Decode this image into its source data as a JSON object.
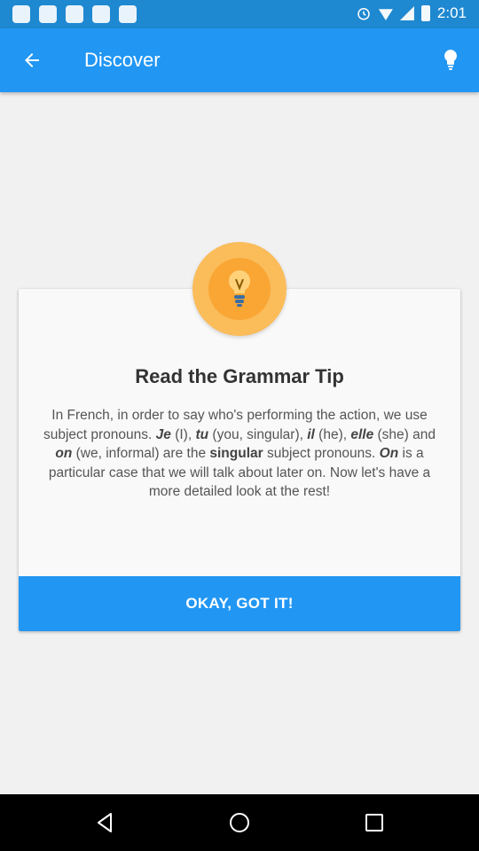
{
  "status_bar": {
    "time": "2:01",
    "icons": [
      "notification-icon",
      "notification-icon",
      "notification-icon",
      "notification-icon",
      "notification-icon",
      "alarm-icon",
      "wifi-icon",
      "cell-signal-icon",
      "battery-icon"
    ]
  },
  "app_bar": {
    "title": "Discover",
    "back_icon": "arrow-back-icon",
    "action_icon": "lightbulb-icon",
    "color": "#2196f3"
  },
  "tip_card": {
    "icon": "lightbulb-icon",
    "title": "Read the Grammar Tip",
    "body": [
      {
        "text": "In French, in order to say who's performing the action, we use subject pronouns. ",
        "style": "normal"
      },
      {
        "text": "Je",
        "style": "bold-italic"
      },
      {
        "text": " (I), ",
        "style": "normal"
      },
      {
        "text": "tu",
        "style": "bold-italic"
      },
      {
        "text": " (you, singular), ",
        "style": "normal"
      },
      {
        "text": "il",
        "style": "bold-italic"
      },
      {
        "text": " (he), ",
        "style": "normal"
      },
      {
        "text": "elle",
        "style": "bold-italic"
      },
      {
        "text": " (she) and ",
        "style": "normal"
      },
      {
        "text": "on",
        "style": "bold-italic"
      },
      {
        "text": " (we, informal) are the ",
        "style": "normal"
      },
      {
        "text": "singular",
        "style": "bold"
      },
      {
        "text": " subject pronouns. ",
        "style": "normal"
      },
      {
        "text": "On",
        "style": "bold-italic"
      },
      {
        "text": " is a particular case that we will talk about later on. Now let's have a more detailed look at the rest!",
        "style": "normal"
      }
    ],
    "button_label": "OKAY, GOT IT!"
  },
  "nav_bar": {
    "back_icon": "nav-back-icon",
    "home_icon": "nav-home-icon",
    "recents_icon": "nav-recents-icon"
  }
}
